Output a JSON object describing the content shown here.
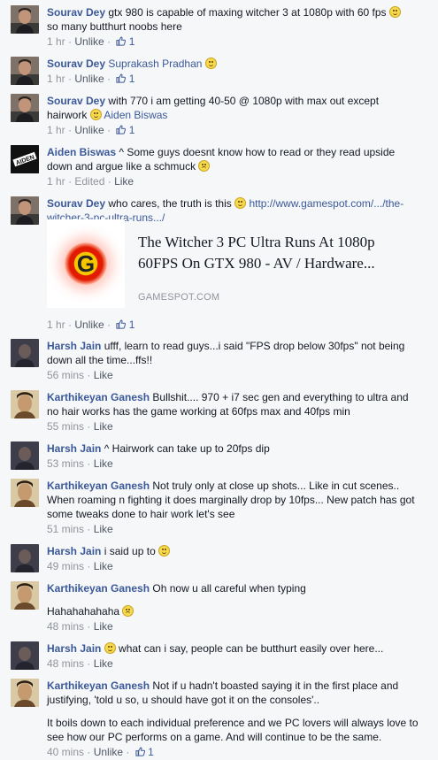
{
  "comments": [
    {
      "author": "Sourav Dey",
      "text": "gtx 980 is capable of maxing witcher 3 at 1080p with 60 fps",
      "text2": "so many butthurt noobs here",
      "time": "1 hr",
      "action": "Unlike",
      "likes": "1"
    },
    {
      "author": "Sourav Dey",
      "mention": "Suprakash Pradhan",
      "time": "1 hr",
      "action": "Unlike",
      "likes": "1"
    },
    {
      "author": "Sourav Dey",
      "text": "with 770 i am getting 40-50 @ 1080p with max out except hairwork",
      "mention": "Aiden Biswas",
      "time": "1 hr",
      "action": "Unlike",
      "likes": "1"
    },
    {
      "author": "Aiden Biswas",
      "text": "^ Some guys doesnt know how to read or they read upside down and argue like a schmuck",
      "time": "1 hr",
      "edited": "Edited",
      "action": "Like",
      "avatar_text": "AIDEN"
    },
    {
      "author": "Sourav Dey",
      "text": "who cares, the truth is this",
      "link": "http://www.gamespot.com/.../the-witcher-3-pc-ultra-runs.../",
      "preview_title": "The Witcher 3 PC Ultra Runs At 1080p 60FPS On GTX 980 - AV / Hardware...",
      "preview_source": "GAMESPOT.COM",
      "preview_logo": "G",
      "time": "1 hr",
      "action": "Unlike",
      "likes": "1"
    },
    {
      "author": "Harsh Jain",
      "text": "ufff, learn to read guys...i said \"FPS drop below 30fps\" not being down all the time...ffs!!",
      "time": "56 mins",
      "action": "Like"
    },
    {
      "author": "Karthikeyan Ganesh",
      "text": "Bullshit.... 970 + i7 sec gen and everything to ultra and no hair works has the game working at 60fps max and 40fps min",
      "time": "55 mins",
      "action": "Like"
    },
    {
      "author": "Harsh Jain",
      "text": "^ Hairwork can take up to 20fps dip",
      "time": "53 mins",
      "action": "Like"
    },
    {
      "author": "Karthikeyan Ganesh",
      "text": "Not truly only at close up shots... Like in cut scenes.. When roaming n fighting it does marginally drop by 10fps... New patch has got some tweaks done to hair work let's see",
      "time": "51 mins",
      "action": "Like"
    },
    {
      "author": "Harsh Jain",
      "text": "i said up to",
      "time": "49 mins",
      "action": "Like"
    },
    {
      "author": "Karthikeyan Ganesh",
      "text": "Oh now u all careful when typing",
      "text2": "Hahahahahaha",
      "time": "48 mins",
      "action": "Like"
    },
    {
      "author": "Harsh Jain",
      "text": "what can i say, people can be butthurt easily over here...",
      "time": "48 mins",
      "action": "Like"
    },
    {
      "author": "Karthikeyan Ganesh",
      "text": "Not if u hadn't boasted saying it in the first place and justifying, 'told u so, u should have got it on the consoles'..",
      "text2": "It boils down to each individual preference and we PC lovers will always love to see how our PC performs on a game. And will continue to be the same.",
      "time": "40 mins",
      "action": "Unlike",
      "likes": "1"
    }
  ],
  "separator": "·",
  "colors": {
    "author": "#3b5998",
    "meta": "#90949c",
    "background": "#f6f7f9"
  }
}
